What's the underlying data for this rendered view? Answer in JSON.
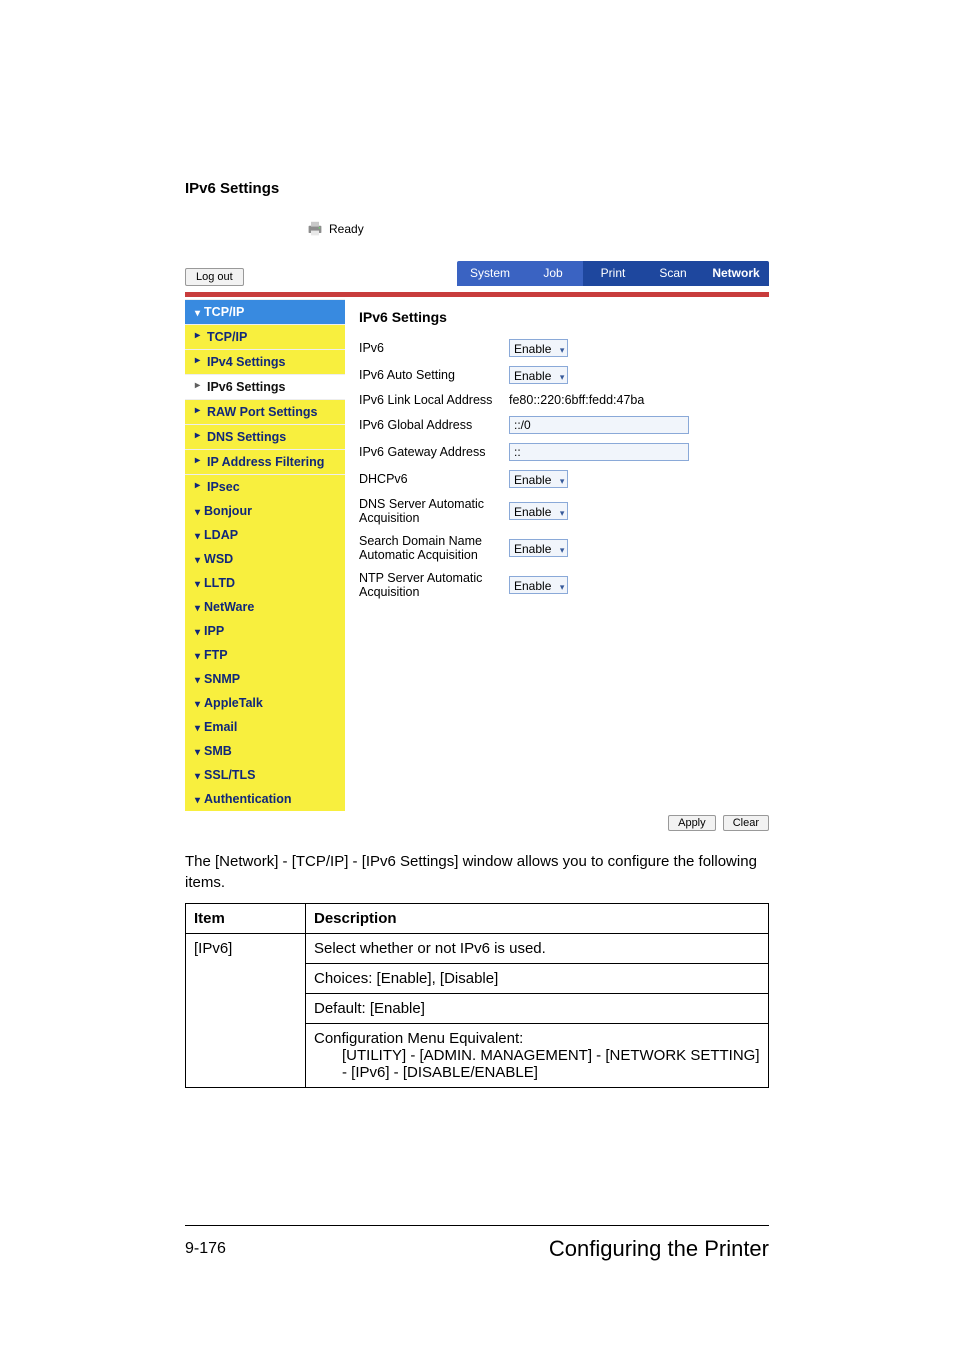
{
  "heading": "IPv6 Settings",
  "status_text": "Ready",
  "buttons": {
    "logout": "Log out",
    "apply": "Apply",
    "clear": "Clear"
  },
  "tabs": {
    "system": "System",
    "job": "Job",
    "print": "Print",
    "scan": "Scan",
    "network": "Network"
  },
  "sidebar": {
    "top": "TCP/IP",
    "items": [
      "TCP/IP",
      "IPv4 Settings",
      "IPv6 Settings",
      "RAW Port Settings",
      "DNS Settings",
      "IP Address Filtering",
      "IPsec"
    ],
    "groups": [
      "Bonjour",
      "LDAP",
      "WSD",
      "LLTD",
      "NetWare",
      "IPP",
      "FTP",
      "SNMP",
      "AppleTalk",
      "Email",
      "SMB",
      "SSL/TLS",
      "Authentication"
    ]
  },
  "content": {
    "title": "IPv6 Settings",
    "rows": {
      "ipv6": {
        "label": "IPv6",
        "value": "Enable"
      },
      "auto": {
        "label": "IPv6 Auto Setting",
        "value": "Enable"
      },
      "link_local": {
        "label": "IPv6 Link Local Address",
        "value": "fe80::220:6bff:fedd:47ba"
      },
      "global": {
        "label": "IPv6 Global Address",
        "value": "::/0"
      },
      "gateway": {
        "label": "IPv6 Gateway Address",
        "value": "::"
      },
      "dhcpv6": {
        "label": "DHCPv6",
        "value": "Enable"
      },
      "dns_auto": {
        "label": "DNS Server Automatic Acquisition",
        "value": "Enable"
      },
      "search_domain_auto": {
        "label": "Search Domain Name Automatic Acquisition",
        "value": "Enable"
      },
      "ntp_auto": {
        "label": "NTP Server Automatic Acquisition",
        "value": "Enable"
      }
    }
  },
  "desc_text": "The [Network] - [TCP/IP] - [IPv6 Settings] window allows you to configure the following items.",
  "table": {
    "headers": {
      "item": "Item",
      "description": "Description"
    },
    "item_name": "[IPv6]",
    "cells": [
      "Select whether or not IPv6 is used.",
      "Choices: [Enable], [Disable]",
      "Default:  [Enable]"
    ],
    "menu_equiv_label": "Configuration Menu Equivalent:",
    "menu_equiv_lines": [
      "[UTILITY] - [ADMIN. MANAGEMENT] - [NETWORK SETTING] - [IPv6] - [DISABLE/ENABLE]"
    ]
  },
  "footer": {
    "page": "9-176",
    "text": "Configuring the Printer"
  }
}
